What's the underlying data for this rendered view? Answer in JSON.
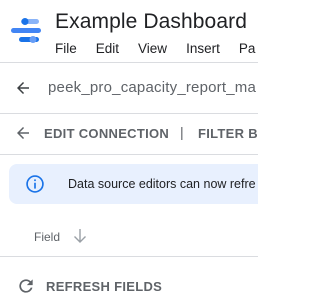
{
  "header": {
    "app_title": "Example Dashboard",
    "menu": [
      "File",
      "Edit",
      "View",
      "Insert",
      "Pa"
    ]
  },
  "data_source": {
    "name": "peek_pro_capacity_report_ma"
  },
  "toolbar": {
    "edit_connection_label": "EDIT CONNECTION",
    "separator": "|",
    "filter_label": "FILTER BY"
  },
  "banner": {
    "text": "Data source editors can now refre",
    "icon": "info-icon"
  },
  "fields": {
    "column_label": "Field",
    "sort_icon": "arrow-down-icon"
  },
  "refresh": {
    "label": "REFRESH FIELDS",
    "icon": "refresh-icon"
  },
  "colors": {
    "logo_dark": "#1a73e8",
    "logo_mid": "#4285f4",
    "logo_light": "#8ab4f8",
    "banner_bg": "#e8f0fe",
    "info_blue": "#1a73e8",
    "divider": "#dadce0"
  }
}
